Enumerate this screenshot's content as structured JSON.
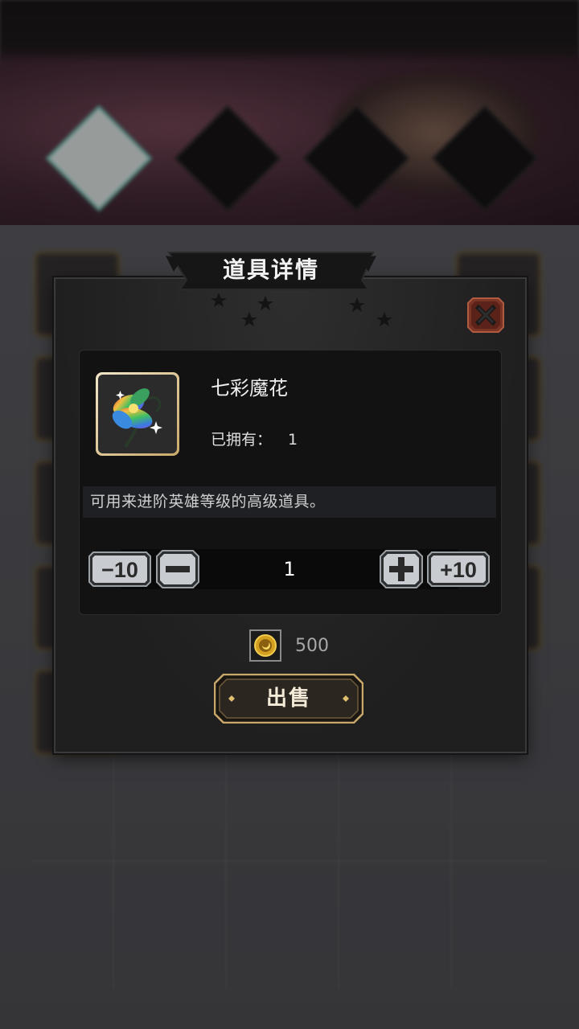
{
  "dialog": {
    "title": "道具详情",
    "item": {
      "name": "七彩魔花",
      "owned_label": "已拥有：",
      "owned_count": "1",
      "description": "可用来进阶英雄等级的高级道具。",
      "icon": "rainbow-flower-icon"
    },
    "quantity": {
      "minus10_label": "−10",
      "minus_label": "−",
      "value": "1",
      "plus_label": "+",
      "plus10_label": "+10"
    },
    "price": {
      "icon": "gold-coin-icon",
      "value": "500"
    },
    "sell_label": "出售",
    "close_icon": "close-x-icon"
  },
  "colors": {
    "dialog_bg": "#242424",
    "panel_bg": "#121212",
    "button_silver": "#c8ccd0",
    "sell_gold": "#c9a86a",
    "close_red": "#8a3a2a"
  }
}
